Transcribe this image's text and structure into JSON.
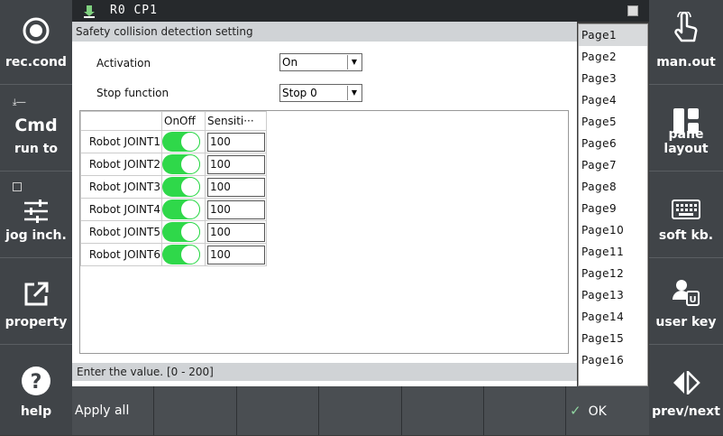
{
  "topbar": {
    "status": "R0 CP1"
  },
  "left_buttons": [
    {
      "label": "rec.cond",
      "icon": "record-icon"
    },
    {
      "label": "run to",
      "title": "Cmd",
      "icon": "cmd-icon"
    },
    {
      "label": "jog inch.",
      "icon": "sliders-icon"
    },
    {
      "label": "property",
      "icon": "external-link-icon"
    },
    {
      "label": "help",
      "icon": "help-icon"
    }
  ],
  "right_buttons": [
    {
      "label": "man.out",
      "icon": "hand-pointer-icon"
    },
    {
      "label": "pane layout",
      "icon": "pane-layout-icon"
    },
    {
      "label": "soft kb.",
      "icon": "keyboard-icon"
    },
    {
      "label": "user key",
      "icon": "user-key-icon"
    },
    {
      "label": "prev/next",
      "icon": "prev-next-icon"
    }
  ],
  "dialog": {
    "title": "Safety collision detection setting",
    "activation_label": "Activation",
    "activation_value": "On",
    "stop_label": "Stop function",
    "stop_value": "Stop 0",
    "table": {
      "headers": [
        "",
        "OnOff",
        "Sensiti···"
      ],
      "rows": [
        {
          "name": "Robot JOINT1",
          "on": true,
          "value": "100"
        },
        {
          "name": "Robot JOINT2",
          "on": true,
          "value": "100"
        },
        {
          "name": "Robot JOINT3",
          "on": true,
          "value": "100"
        },
        {
          "name": "Robot JOINT4",
          "on": true,
          "value": "100"
        },
        {
          "name": "Robot JOINT5",
          "on": true,
          "value": "100"
        },
        {
          "name": "Robot JOINT6",
          "on": true,
          "value": "100"
        }
      ]
    },
    "status": "Enter the value. [0 - 200]"
  },
  "pages": [
    "Page1",
    "Page2",
    "Page3",
    "Page4",
    "Page5",
    "Page6",
    "Page7",
    "Page8",
    "Page9",
    "Page10",
    "Page11",
    "Page12",
    "Page13",
    "Page14",
    "Page15",
    "Page16"
  ],
  "bottom": {
    "apply_all": "Apply all",
    "ok": "OK"
  },
  "colors": {
    "toggle_on": "#2fd84a",
    "panel": "#404448"
  }
}
